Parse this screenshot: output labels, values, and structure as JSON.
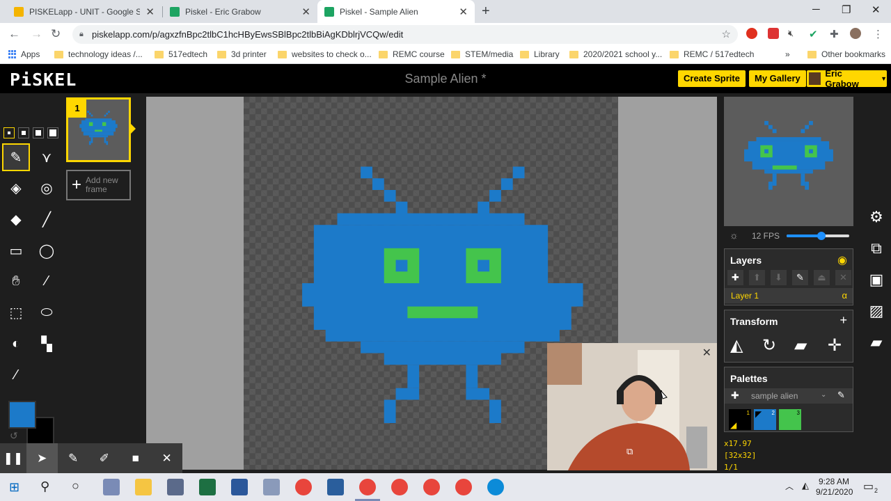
{
  "browser": {
    "tabs": [
      {
        "title": "PISKELapp - UNIT - Google Slide",
        "active": false,
        "favicon_color": "#f4b400"
      },
      {
        "title": "Piskel - Eric Grabow",
        "active": false,
        "favicon_color": "#1da462"
      },
      {
        "title": "Piskel - Sample Alien",
        "active": true,
        "favicon_color": "#1da462"
      }
    ],
    "new_tab_glyph": "+",
    "url": "piskelapp.com/p/agxzfnBpc2tlbC1hcHByEwsSBlBpc2tlbBiAgKDblrjVCQw/edit",
    "bookmarks": [
      {
        "label": "Apps",
        "type": "apps"
      },
      {
        "label": "technology ideas /...",
        "type": "folder"
      },
      {
        "label": "517edtech",
        "type": "folder"
      },
      {
        "label": "3d printer",
        "type": "folder"
      },
      {
        "label": "websites to check o...",
        "type": "folder"
      },
      {
        "label": "REMC course",
        "type": "folder"
      },
      {
        "label": "STEM/media",
        "type": "folder"
      },
      {
        "label": "Library",
        "type": "folder"
      },
      {
        "label": "2020/2021 school y...",
        "type": "folder"
      },
      {
        "label": "REMC / 517edtech",
        "type": "folder"
      }
    ],
    "other_bookmarks": "Other bookmarks"
  },
  "piskel": {
    "logo": "PiSKEL",
    "title": "Sample Alien *",
    "create_sprite": "Create Sprite",
    "my_gallery": "My Gallery",
    "user_name": "Eric Grabow",
    "frame_number": "1",
    "add_frame": "Add new frame",
    "fps": "12 FPS",
    "fps_fraction": 0.55,
    "layers": {
      "title": "Layers",
      "layer_name": "Layer 1",
      "alpha_glyph": "α"
    },
    "transform": {
      "title": "Transform"
    },
    "palettes": {
      "title": "Palettes",
      "selected": "sample alien",
      "swatches": [
        {
          "num": "1",
          "color": "#000000"
        },
        {
          "num": "2",
          "color": "#1c7ac9"
        },
        {
          "num": "3",
          "color": "#44c44c"
        }
      ]
    },
    "coords": "x17.97",
    "size": "[32x32]",
    "frame_index": "1/1",
    "colors": {
      "primary": "#1c7ac9",
      "secondary": "#000000",
      "accent": "#ffd700",
      "alien_body": "#1c7ac9",
      "alien_eye": "#44c44c"
    }
  },
  "taskbar": {
    "time": "9:28 AM",
    "date": "9/21/2020",
    "notif_count": "2"
  }
}
